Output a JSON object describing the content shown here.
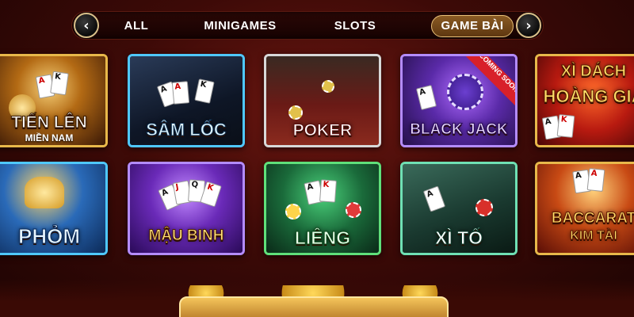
{
  "nav": {
    "tabs": [
      "ALL",
      "MINIGAMES",
      "SLOTS",
      "GAME BÀI"
    ],
    "active_tab": "GAME BÀI",
    "prev_arrow": "‹",
    "next_arrow": "›"
  },
  "games": [
    {
      "title": "TIẾN LÊN",
      "subtitle": "MIỀN NAM"
    },
    {
      "title": "SÂM LỐC"
    },
    {
      "title": "POKER"
    },
    {
      "title": "BLACK JACK",
      "badge": "COMING SOON"
    },
    {
      "title": "XÌ DÁCH",
      "subtitle": "HOÀNG GIA"
    },
    {
      "title": "PHỎM"
    },
    {
      "title": "MẬU BINH"
    },
    {
      "title": "LIÊNG"
    },
    {
      "title": "XÌ TỐ"
    },
    {
      "title": "BACCARAT",
      "subtitle": "KIM TÀI"
    }
  ],
  "colors": {
    "background": "#3d0a07",
    "active_tab": "#7a4a1c",
    "gold": "#e8b84a"
  }
}
